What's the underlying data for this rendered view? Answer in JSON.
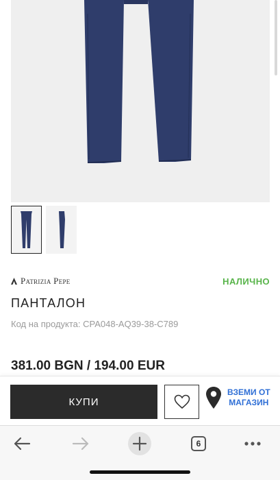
{
  "product": {
    "brand": "Patrizia Pepe",
    "stock_status": "НАЛИЧНО",
    "title": "ПАНТАЛОН",
    "sku": "Код на продукта: CPA048-AQ39-38-C789",
    "price": "381.00 BGN / 194.00 EUR",
    "image": "navy-trousers-photo",
    "thumbnails": [
      "navy-trousers-front",
      "navy-trousers-side"
    ]
  },
  "actions": {
    "buy_label": "КУПИ",
    "wishlist_icon": "heart-icon",
    "pickup_line1": "ВЗЕМИ ОТ",
    "pickup_line2": "МАГАЗИН",
    "pickup_icon": "location-pin-icon"
  },
  "browser": {
    "tab_count": "6",
    "icons": [
      "back-arrow-icon",
      "forward-arrow-icon",
      "new-tab-plus-icon",
      "tabs-icon",
      "more-dots-icon"
    ]
  },
  "colors": {
    "stock_green": "#58b44a",
    "pickup_blue": "#2f6fd6",
    "buy_button": "#2b2b2b",
    "trousers_navy": "#2f3d6b"
  }
}
